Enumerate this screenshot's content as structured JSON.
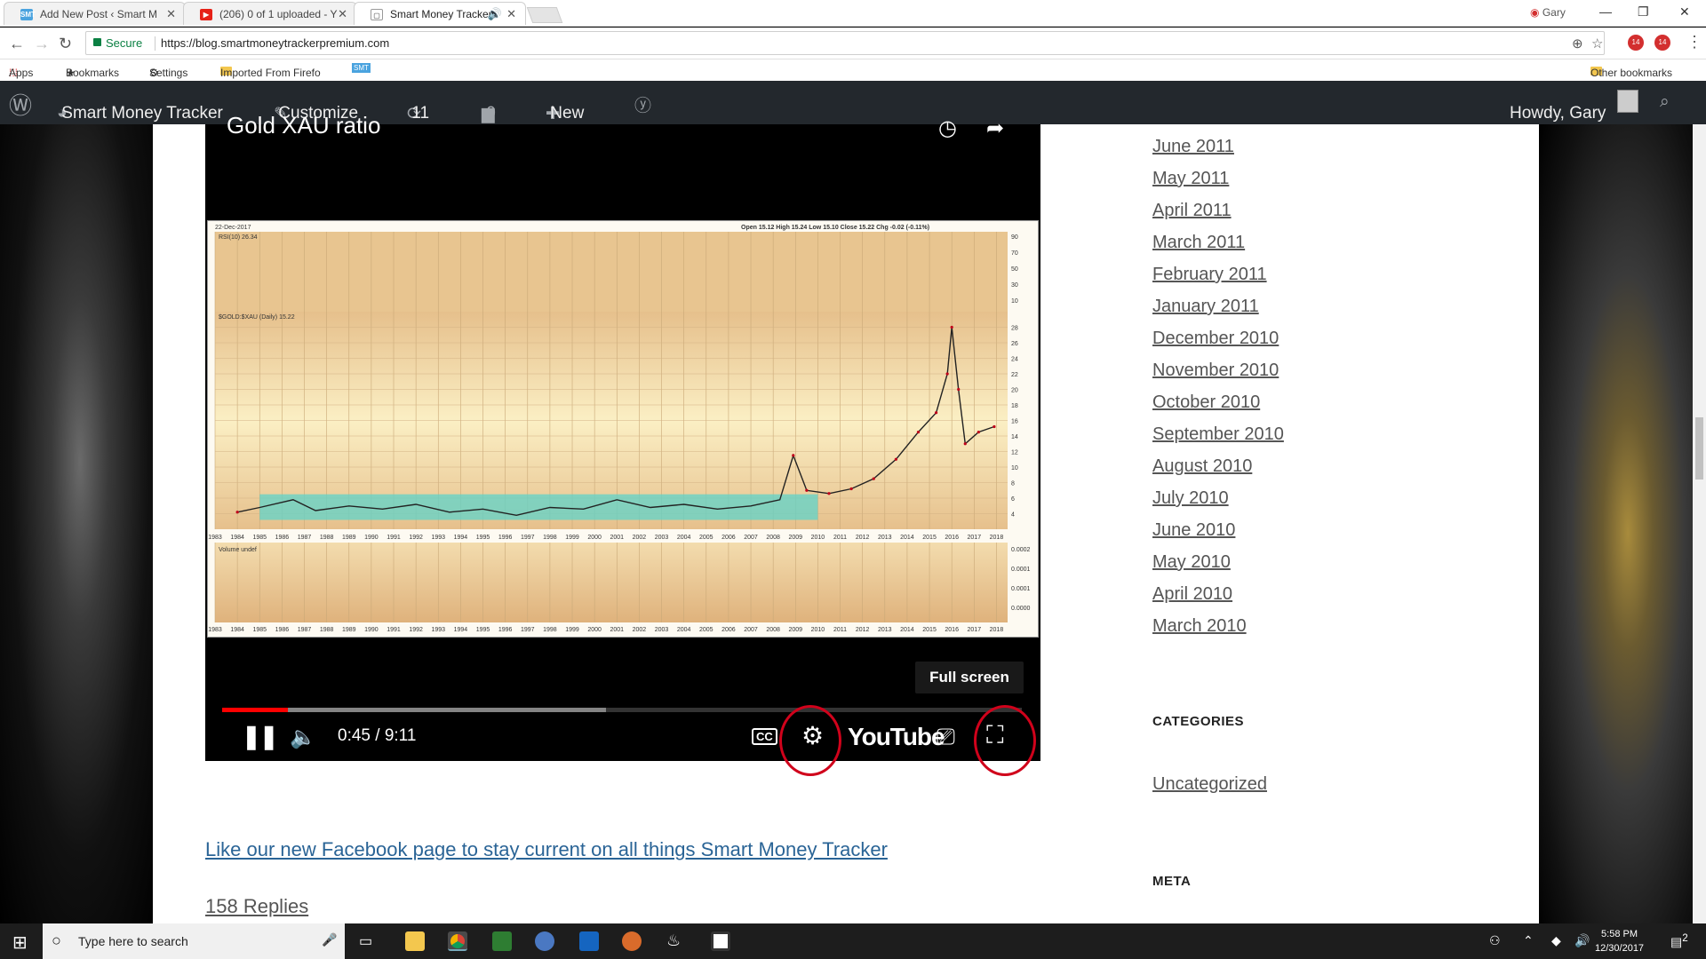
{
  "browser": {
    "tabs": [
      {
        "title": "Add New Post ‹ Smart M",
        "favicon": "SMT",
        "favicon_color": "#4aa3df"
      },
      {
        "title": "(206) 0 of 1 uploaded - Y",
        "favicon": "▶",
        "favicon_color": "#e62117"
      },
      {
        "title": "Smart Money Tracker",
        "favicon": "▢",
        "favicon_color": "#999999"
      }
    ],
    "profile": "Gary",
    "secure_label": "Secure",
    "url": "https://blog.smartmoneytrackerpremium.com",
    "extension_badges": [
      "14",
      "14"
    ],
    "bookmarks": [
      "Apps",
      "Bookmarks",
      "Settings",
      "Imported From Firefo"
    ],
    "bookmarks_smt": "SMT",
    "other_bookmarks": "Other bookmarks"
  },
  "wp_admin": {
    "site_name": "Smart Money Tracker",
    "customize": "Customize",
    "updates_count": "11",
    "comments_count": "0",
    "new_label": "New",
    "howdy": "Howdy, Gary"
  },
  "video": {
    "title": "Gold XAU ratio",
    "current_time": "0:45",
    "duration": "9:11",
    "time_display": "0:45 / 9:11",
    "played_fraction": 0.082,
    "buffered_fraction": 0.48,
    "fullscreen_tooltip": "Full screen",
    "cc_label": "CC",
    "youtube_logo": "YouTube",
    "chart": {
      "date": "22-Dec-2017",
      "ohlc_text": "Open 15.12  High 15.24  Low 15.10  Close 15.22  Chg -0.02 (-0.11%)",
      "rsi_label": "RSI(10) 26.34",
      "price_label": "$GOLD:$XAU (Daily) 15.22",
      "volume_label": "Volume undef",
      "years": [
        "1983",
        "1984",
        "1985",
        "1986",
        "1987",
        "1988",
        "1989",
        "1990",
        "1991",
        "1992",
        "1993",
        "1994",
        "1995",
        "1996",
        "1997",
        "1998",
        "1999",
        "2000",
        "2001",
        "2002",
        "2003",
        "2004",
        "2005",
        "2006",
        "2007",
        "2008",
        "2009",
        "2010",
        "2011",
        "2012",
        "2013",
        "2014",
        "2015",
        "2016",
        "2017",
        "2018"
      ],
      "rsi_ticks": [
        "90",
        "70",
        "50",
        "30",
        "10"
      ],
      "price_ticks": [
        "28",
        "26",
        "24",
        "22",
        "20",
        "18",
        "16",
        "14",
        "12",
        "10",
        "8",
        "6",
        "4"
      ],
      "volume_ticks": [
        "0.0002",
        "0.0001",
        "0.0001",
        "0.0000"
      ],
      "series": [
        {
          "x": 1984.0,
          "y": 4.2
        },
        {
          "x": 1985.0,
          "y": 4.8
        },
        {
          "x": 1986.5,
          "y": 5.8
        },
        {
          "x": 1987.5,
          "y": 4.4
        },
        {
          "x": 1989.0,
          "y": 5.0
        },
        {
          "x": 1990.5,
          "y": 4.6
        },
        {
          "x": 1992.0,
          "y": 5.2
        },
        {
          "x": 1993.5,
          "y": 4.2
        },
        {
          "x": 1995.0,
          "y": 4.6
        },
        {
          "x": 1996.5,
          "y": 3.8
        },
        {
          "x": 1998.0,
          "y": 4.8
        },
        {
          "x": 1999.5,
          "y": 4.6
        },
        {
          "x": 2001.0,
          "y": 5.8
        },
        {
          "x": 2002.5,
          "y": 4.8
        },
        {
          "x": 2004.0,
          "y": 5.2
        },
        {
          "x": 2005.5,
          "y": 4.6
        },
        {
          "x": 2007.0,
          "y": 5.0
        },
        {
          "x": 2008.3,
          "y": 5.8
        },
        {
          "x": 2008.9,
          "y": 11.5
        },
        {
          "x": 2009.5,
          "y": 7.0
        },
        {
          "x": 2010.5,
          "y": 6.6
        },
        {
          "x": 2011.5,
          "y": 7.2
        },
        {
          "x": 2012.5,
          "y": 8.5
        },
        {
          "x": 2013.5,
          "y": 11.0
        },
        {
          "x": 2014.5,
          "y": 14.5
        },
        {
          "x": 2015.3,
          "y": 17.0
        },
        {
          "x": 2015.8,
          "y": 22.0
        },
        {
          "x": 2016.0,
          "y": 28.0
        },
        {
          "x": 2016.3,
          "y": 20.0
        },
        {
          "x": 2016.6,
          "y": 13.0
        },
        {
          "x": 2017.2,
          "y": 14.5
        },
        {
          "x": 2017.9,
          "y": 15.2
        }
      ],
      "highlight_box": {
        "x_from": 1985,
        "x_to": 2010,
        "y_from": 3.2,
        "y_to": 6.5
      }
    }
  },
  "post": {
    "facebook_link": "Like our new Facebook page to stay current on all things Smart Money Tracker",
    "replies": "158 Replies"
  },
  "sidebar": {
    "archives": [
      "June 2011",
      "May 2011",
      "April 2011",
      "March 2011",
      "February 2011",
      "January 2011",
      "December 2010",
      "November 2010",
      "October 2010",
      "September 2010",
      "August 2010",
      "July 2010",
      "June 2010",
      "May 2010",
      "April 2010",
      "March 2010"
    ],
    "categories_title": "CATEGORIES",
    "categories": [
      "Uncategorized"
    ],
    "meta_title": "META"
  },
  "taskbar": {
    "search_placeholder": "Type here to search",
    "time": "5:58 PM",
    "date": "12/30/2017",
    "notification_count": "2"
  }
}
